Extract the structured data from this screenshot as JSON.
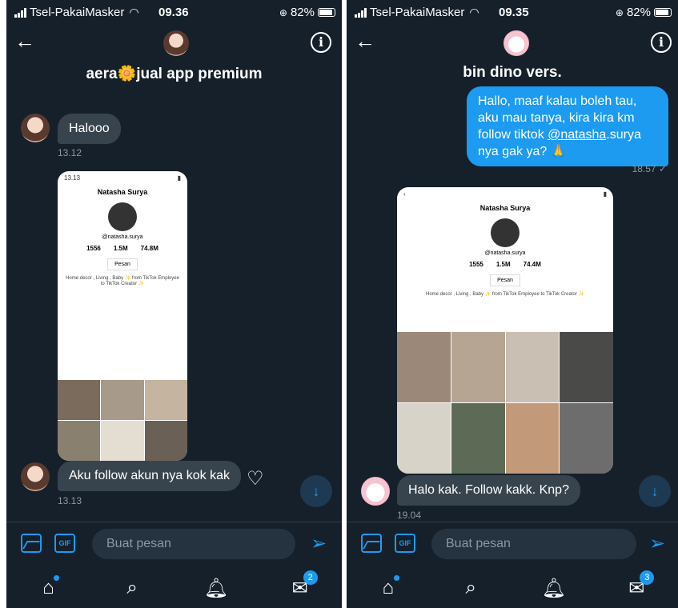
{
  "left": {
    "status": {
      "carrier": "Tsel-PakaiMasker",
      "time": "09.36",
      "battery": "82%"
    },
    "header": {
      "title": "aera🌼jual app premium"
    },
    "messages": [
      {
        "text": "Halooo",
        "time": "13.12"
      },
      {
        "text": "Aku follow akun nya kok kak",
        "time": "13.13"
      }
    ],
    "screenshot": {
      "name": "Natasha Surya",
      "handle": "@natasha.surya",
      "stats": [
        "1556",
        "1.5M",
        "74.8M"
      ],
      "button": "Pesan",
      "bio": "Home decor , Living , Baby ✨ from TikTok Employee to TikTok Creator ✨"
    },
    "composer": {
      "placeholder": "Buat pesan",
      "gif_label": "GIF"
    },
    "tabbar": {
      "badge": "2"
    }
  },
  "right": {
    "status": {
      "carrier": "Tsel-PakaiMasker",
      "time": "09.35",
      "battery": "82%"
    },
    "header": {
      "title": "bin dino vers."
    },
    "outgoing": {
      "text_before": "Hallo, maaf kalau boleh tau, aku mau tanya, kira kira km follow tiktok ",
      "mention": "@natasha",
      "text_after": ".surya nya gak ya? 🙏",
      "time": "18.57 ✓"
    },
    "screenshot": {
      "name": "Natasha Surya",
      "handle": "@natasha.surya",
      "stats": [
        "1555",
        "1.5M",
        "74.4M"
      ],
      "button": "Pesan",
      "bio": "Home decor , Living , Baby ✨ from TikTok Employee to TikTok Creator ✨"
    },
    "messages": [
      {
        "text": "Halo kak. Follow kakk. Knp?",
        "time": "19.04"
      }
    ],
    "composer": {
      "placeholder": "Buat pesan",
      "gif_label": "GIF"
    },
    "tabbar": {
      "badge": "3"
    }
  },
  "colors": {
    "background": "#15202b",
    "accent": "#1d9bf0",
    "bubble_in": "#38444d"
  },
  "icons": [
    "back-arrow-icon",
    "info-icon",
    "heart-plus-icon",
    "scroll-down-icon",
    "image-icon",
    "gif-icon",
    "send-icon",
    "home-icon",
    "search-icon",
    "bell-icon",
    "mail-icon"
  ]
}
